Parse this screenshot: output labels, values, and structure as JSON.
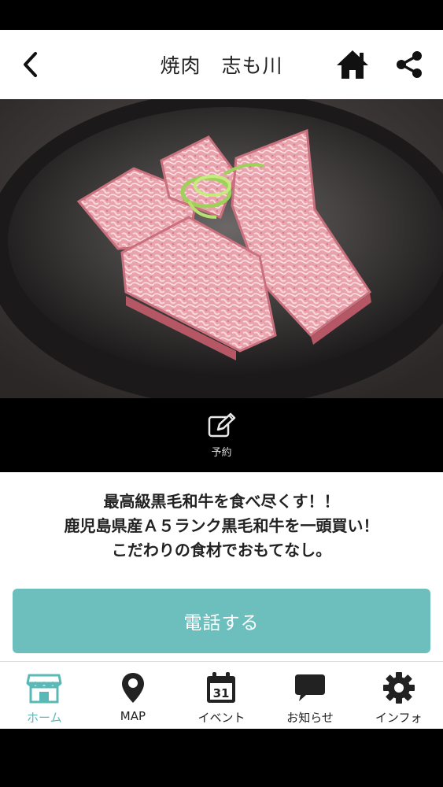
{
  "header": {
    "title": "焼肉　志も川",
    "icons": {
      "back": "chevron-left-icon",
      "home": "home-icon",
      "share": "share-icon"
    }
  },
  "hero": {
    "image": "wagyu-beef-plate-photo"
  },
  "reserve": {
    "label": "予約",
    "icon": "pencil-edit-icon"
  },
  "catch": {
    "line1": "最高級黒毛和牛を食べ尽くす！！",
    "line2": "鹿児島県産Ａ５ランク黒毛和牛を一頭買い！",
    "line3": "こだわりの食材でおもてなし。"
  },
  "call_button": {
    "label": "電話する"
  },
  "tabbar": {
    "items": [
      {
        "label": "ホーム",
        "icon": "store-icon",
        "active": true
      },
      {
        "label": "MAP",
        "icon": "map-pin-icon",
        "active": false
      },
      {
        "label": "イベント",
        "icon": "calendar-icon",
        "calendar_day": "31",
        "active": false
      },
      {
        "label": "お知らせ",
        "icon": "speech-bubble-icon",
        "active": false
      },
      {
        "label": "インフォ",
        "icon": "gear-icon",
        "active": false
      }
    ]
  },
  "colors": {
    "accent": "#6dbfbe",
    "tab_active": "#5ab9b6",
    "text": "#222222"
  }
}
